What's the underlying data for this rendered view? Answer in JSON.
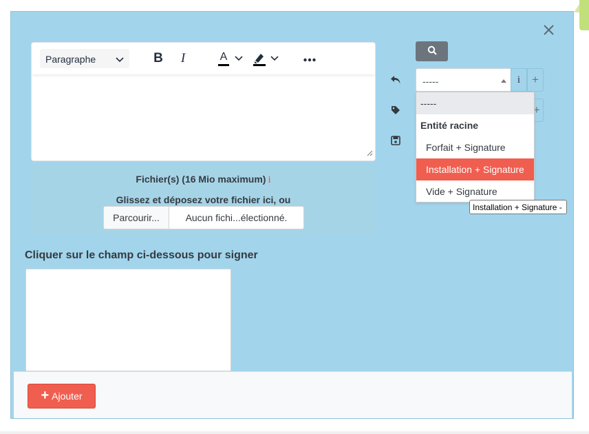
{
  "dialog": {
    "close_icon": "close-icon"
  },
  "editor": {
    "block_format": "Paragraphe",
    "toolbar_icons": [
      "bold-icon",
      "italic-icon",
      "text-color-icon",
      "highlight-icon",
      "more-icon"
    ],
    "bold_glyph": "B",
    "italic_glyph": "I",
    "forecolor_glyph": "A",
    "text_color": "#000000",
    "highlight_color": "#000000"
  },
  "upload": {
    "title": "Fichier(s) (16 Mio maximum)",
    "info_glyph": "i",
    "drop_hint": "Glissez et déposez votre fichier ici, ou",
    "browse_label": "Parcourir...",
    "no_file_label": "Aucun fichi...électionné."
  },
  "side_icons": [
    "undo-icon",
    "tag-icon",
    "save-icon"
  ],
  "template_picker": {
    "search_icon": "search-icon",
    "selected_value": "-----",
    "info_glyph": "i",
    "plus_glyph": "+",
    "options": [
      {
        "label": "-----",
        "kind": "selected"
      },
      {
        "label": "Entité racine",
        "kind": "group"
      },
      {
        "label": "Forfait + Signature",
        "kind": "option"
      },
      {
        "label": "Installation + Signature",
        "kind": "highlight"
      },
      {
        "label": "Vide + Signature",
        "kind": "option"
      }
    ],
    "tooltip": "Installation + Signature -"
  },
  "signature": {
    "label": "Cliquer sur le champ ci-dessous pour signer"
  },
  "footer": {
    "add_glyph": "+",
    "add_label": "Ajouter"
  },
  "colors": {
    "modal_bg": "#a2d5ec",
    "accent_red": "#f05e4f",
    "search_gray": "#6c757d",
    "green_tab": "#c2e07a"
  }
}
